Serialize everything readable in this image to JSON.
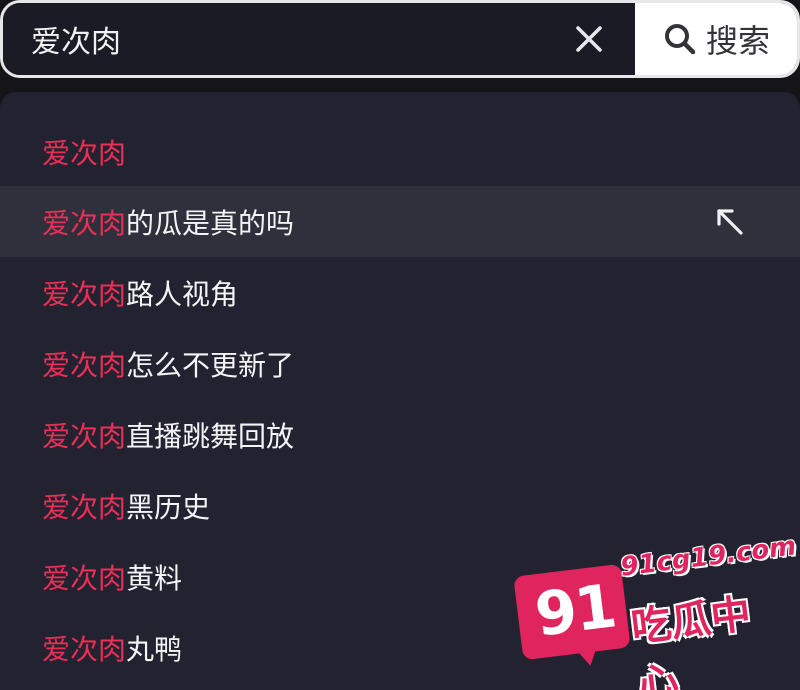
{
  "search": {
    "query": "爱次肉",
    "button_label": "搜索"
  },
  "suggestions": [
    {
      "keyword": "爱次肉",
      "rest": ""
    },
    {
      "keyword": "爱次肉",
      "rest": "的瓜是真的吗",
      "highlighted": true
    },
    {
      "keyword": "爱次肉",
      "rest": "路人视角"
    },
    {
      "keyword": "爱次肉",
      "rest": "怎么不更新了"
    },
    {
      "keyword": "爱次肉",
      "rest": "直播跳舞回放"
    },
    {
      "keyword": "爱次肉",
      "rest": "黑历史"
    },
    {
      "keyword": "爱次肉",
      "rest": "黄料"
    },
    {
      "keyword": "爱次肉",
      "rest": "丸鸭"
    }
  ],
  "watermark": {
    "number": "91",
    "domain": "91cg19.com",
    "name": "吃瓜中心"
  },
  "colors": {
    "keyword": "#ea2f57",
    "panel": "#222230",
    "highlight_row": "#30303c",
    "watermark": "#e0245e"
  },
  "icons": {
    "clear": "close-icon",
    "search": "search-icon",
    "fill": "arrow-up-left-icon"
  }
}
